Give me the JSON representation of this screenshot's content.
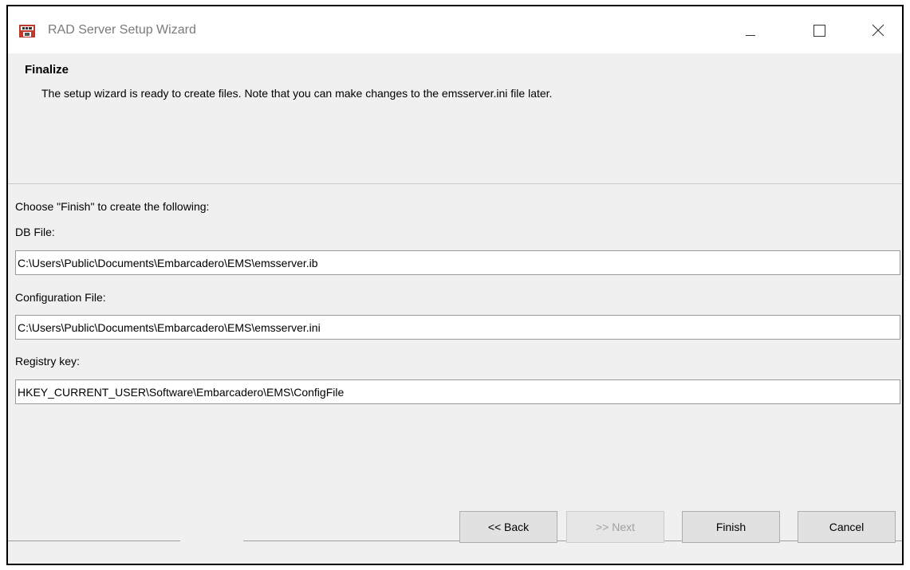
{
  "window": {
    "title": "RAD Server Setup Wizard"
  },
  "header": {
    "title": "Finalize",
    "description": "The setup wizard is ready to create files.  Note that you can make changes to the emsserver.ini file later."
  },
  "content": {
    "intro": "Choose \"Finish\" to create the following:",
    "db_label": "DB File:",
    "db_value": "C:\\Users\\Public\\Documents\\Embarcadero\\EMS\\emsserver.ib",
    "config_label": "Configuration File:",
    "config_value": "C:\\Users\\Public\\Documents\\Embarcadero\\EMS\\emsserver.ini",
    "registry_label": "Registry key:",
    "registry_value": "HKEY_CURRENT_USER\\Software\\Embarcadero\\EMS\\ConfigFile"
  },
  "buttons": {
    "back": "<< Back",
    "next": ">> Next",
    "finish": "Finish",
    "cancel": "Cancel"
  },
  "icons": {
    "app": "app-installer-icon",
    "minimize": "minimize-icon",
    "maximize": "maximize-icon",
    "close": "close-icon"
  }
}
